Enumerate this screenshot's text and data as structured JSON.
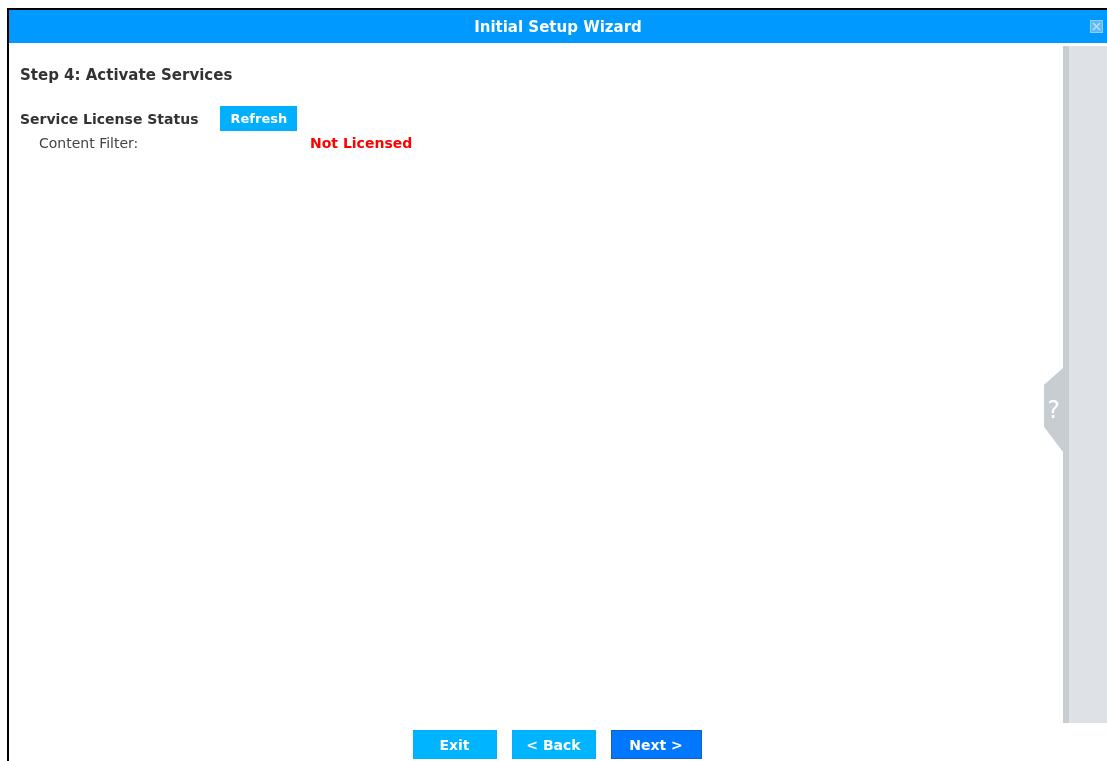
{
  "window": {
    "title": "Initial Setup Wizard"
  },
  "step_title": "Step 4: Activate Services",
  "section": {
    "title": "Service License Status",
    "refresh_button": "Refresh"
  },
  "services": [
    {
      "name": "Content Filter:",
      "status": "Not Licensed",
      "licensed": false
    }
  ],
  "help_tab": {
    "label": "?"
  },
  "buttons": [
    {
      "label": "Exit",
      "primary": false
    },
    {
      "label": "< Back",
      "primary": false
    },
    {
      "label": "Next >",
      "primary": true
    }
  ]
}
